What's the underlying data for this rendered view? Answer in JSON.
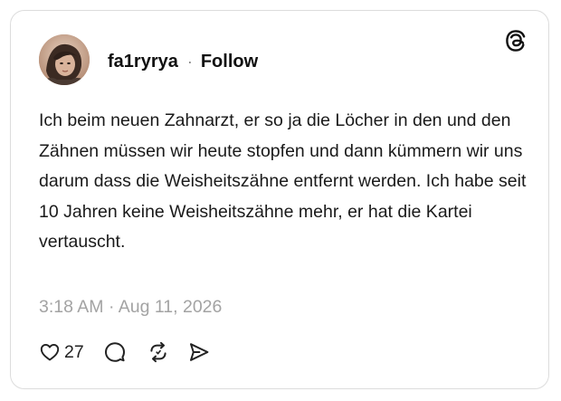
{
  "post": {
    "username": "fa1ryrya",
    "separator": "·",
    "follow_label": "Follow",
    "text": "Ich beim neuen Zahnarzt, er so ja die Löcher in den und den Zähnen müssen wir heute stopfen und dann kümmern wir uns darum dass die Weisheitszähne entfernt werden. Ich habe seit 10 Jahren keine Weisheitszähne mehr, er hat die Kartei vertauscht.",
    "timestamp": "3:18 AM · Aug 11, 2026",
    "like_count": "27"
  },
  "icons": {
    "logo": "threads-logo-icon",
    "like": "heart-icon",
    "comment": "comment-bubble-icon",
    "repost": "repost-icon",
    "share": "send-icon"
  },
  "colors": {
    "text": "#111111",
    "muted": "#a3a3a3",
    "border": "#dcdcdc"
  }
}
